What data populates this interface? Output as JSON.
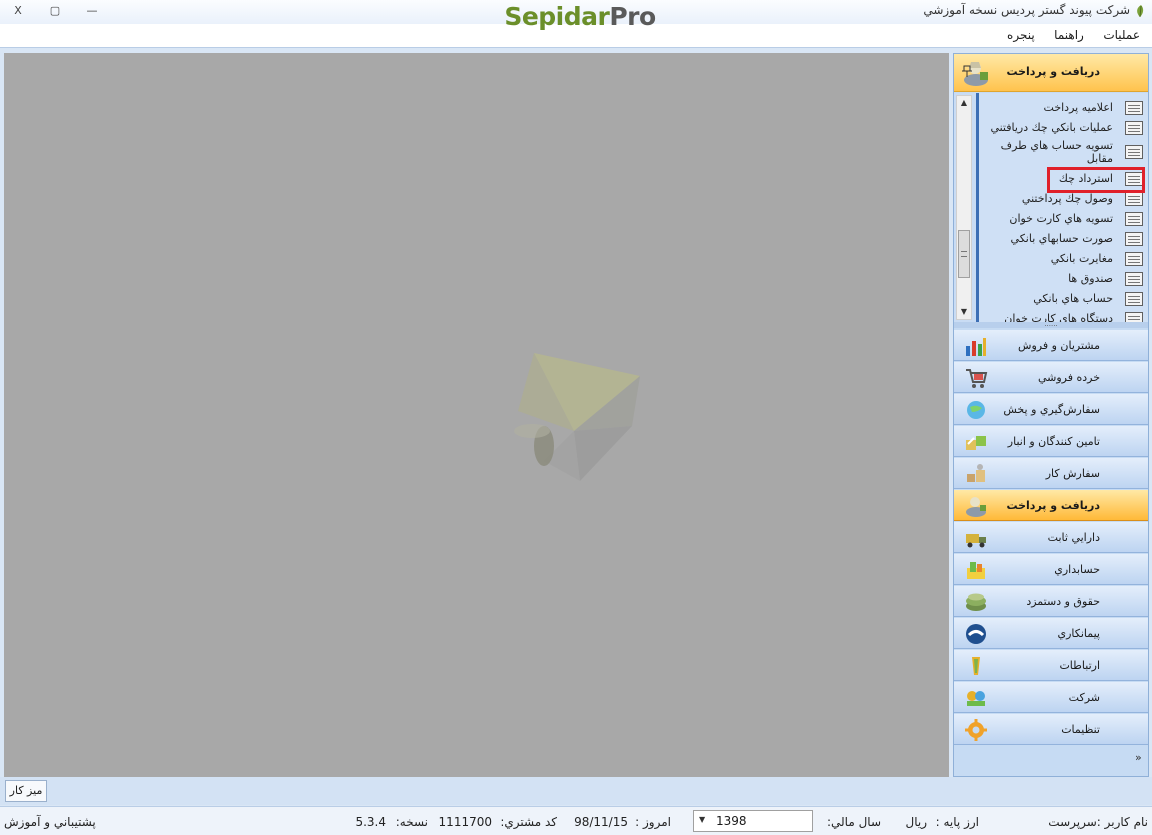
{
  "window": {
    "title": "شركت پيوند گستر پرديس نسخه آموزشي",
    "logo_part1": "Sepidar",
    "logo_part2": "Pro",
    "close_glyph": "X",
    "maximize_glyph": "▢",
    "minimize_glyph": "—"
  },
  "menubar": {
    "items": [
      "عمليات",
      "راهنما",
      "پنجره"
    ]
  },
  "panel": {
    "header_label": "دريافت و پرداخت",
    "tasks": [
      "اعلاميه پرداخت",
      "عمليات بانكي چك دريافتني",
      "تسويه حساب هاي طرف مقابل",
      "استرداد چك",
      "وصول چك پرداختني",
      "تسويه هاي كارت خوان",
      "صورت حسابهاي بانكي",
      "مغايرت بانكي",
      "صندوق ها",
      "حساب هاي بانكي",
      "دستگاه هاي كارت خوان"
    ],
    "highlighted_task": "استرداد چك",
    "splitter_glyph": "......",
    "categories": [
      "مشتريان و فروش",
      "خرده فروشي",
      "سفارش‌گيري و پخش",
      "تامين كنندگان و انبار",
      "سفارش كار",
      "دريافت و پرداخت",
      "دارايي ثابت",
      "حسابداري",
      "حقوق و دستمزد",
      "پيمانكاري",
      "ارتباطات",
      "شركت",
      "تنظيمات"
    ],
    "active_category": "دريافت و پرداخت",
    "more_glyph": "»"
  },
  "desk_tab": {
    "label": "ميز كار"
  },
  "statusbar": {
    "user": "نام كاربر :سرپرست",
    "currency_label": "ارز پايه :",
    "currency_value": "ريال",
    "fiscal_year_label": "سال مالي:",
    "fiscal_year_value": "1398",
    "today_label": "امروز :",
    "today_value": "98/11/15",
    "customer_code_label": "كد مشتري:",
    "customer_code_value": "1111700",
    "version_label": "نسخه:",
    "version_value": "5.3.4",
    "support": "پشتيباني و آموزش"
  },
  "colors": {
    "accent": "#ffc34d",
    "highlight": "#e0202a",
    "workspace": "#a8a8a8",
    "logo_green": "#6b8f2a"
  },
  "icons": {
    "app": "leaf-icon",
    "pin": "pin-icon",
    "task": "document-list-icon"
  }
}
